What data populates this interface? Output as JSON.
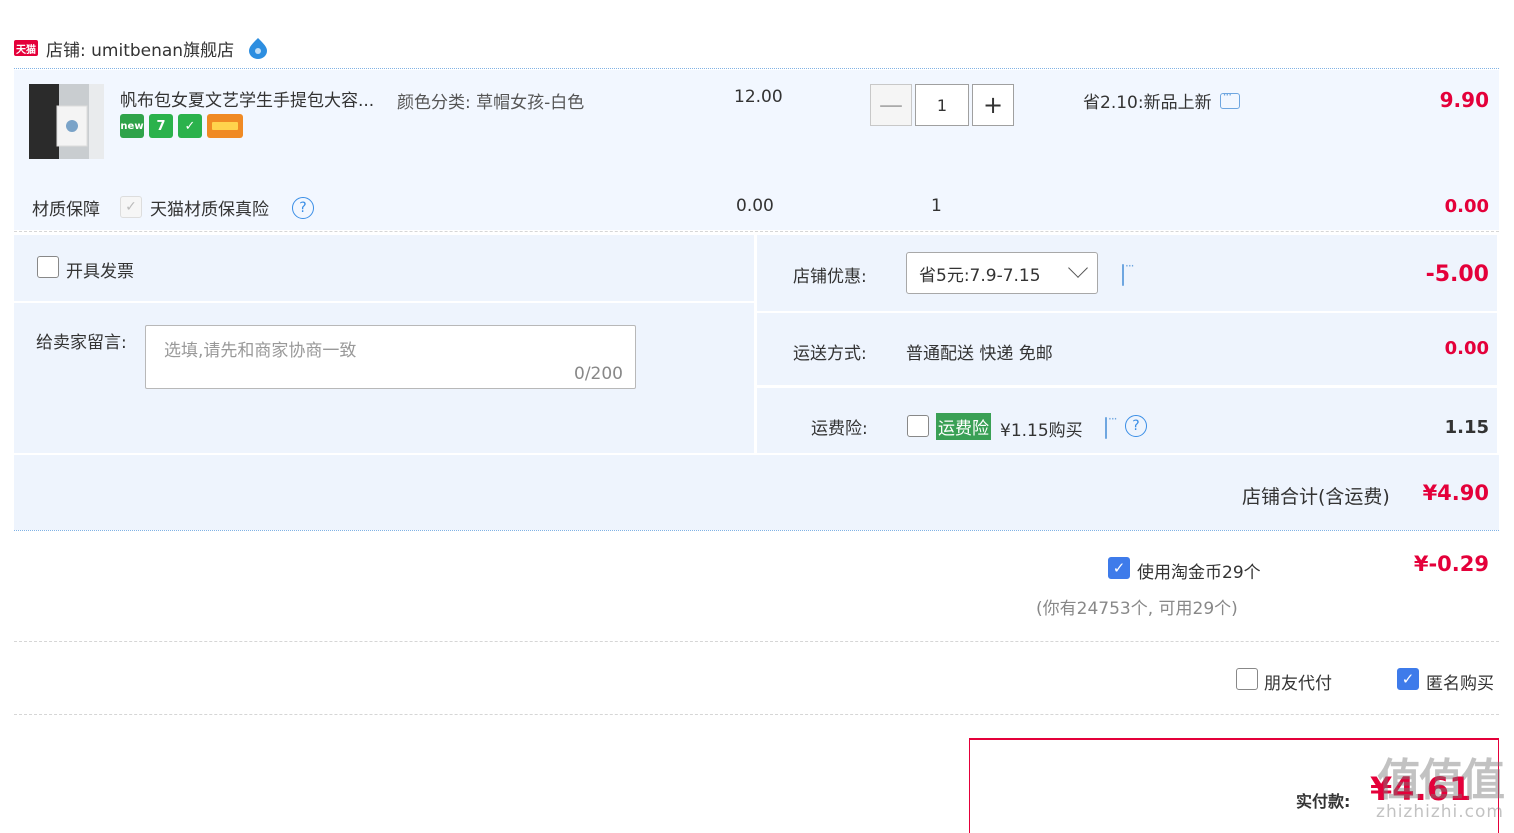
{
  "shop": {
    "badge": "天猫",
    "name": "店铺: umitbenan旗舰店"
  },
  "item": {
    "title": "帆布包女夏文艺学生手提包大容...",
    "sku": "颜色分类: 草帽女孩-白色",
    "price": "12.00",
    "quantity": "1",
    "minus_label": "—",
    "plus_label": "+",
    "promo": "省2.10:新品上新",
    "total": "9.90",
    "badges": [
      {
        "icon": "tmall-new-icon",
        "text": "new",
        "color": "#2fa34a"
      },
      {
        "icon": "seven-day-return-icon",
        "text": "7",
        "color": "#2bb24c"
      },
      {
        "icon": "tmall-guarantee-icon",
        "text": "✓",
        "color": "#2bb24c"
      },
      {
        "icon": "credit-card-icon",
        "text": "",
        "color": "#f08a24"
      }
    ]
  },
  "material": {
    "label": "材质保障",
    "name": "天猫材质保真险",
    "price": "0.00",
    "quantity": "1",
    "total": "0.00"
  },
  "invoice": {
    "label": "开具发票"
  },
  "message": {
    "label": "给卖家留言:",
    "placeholder": "选填,请先和商家协商一致",
    "count": "0/200"
  },
  "discount": {
    "label": "店铺优惠:",
    "selected": "省5元:7.9-7.15",
    "amount": "-5.00"
  },
  "shipping": {
    "label": "运送方式:",
    "method": "普通配送 快递 免邮",
    "amount": "0.00"
  },
  "insurance": {
    "label": "运费险:",
    "tag": "运费险",
    "price_text": "¥1.15购买",
    "amount": "1.15"
  },
  "subtotal": {
    "label": "店铺合计(含运费)",
    "amount": "¥4.90"
  },
  "coins": {
    "label": "使用淘金币29个",
    "amount": "¥-0.29",
    "note": "(你有24753个, 可用29个)"
  },
  "options": {
    "friend_pay": "朋友代付",
    "anonymous": "匿名购买"
  },
  "payment": {
    "label": "实付款:",
    "amount": "¥4.61"
  },
  "watermark": {
    "big": "值值值",
    "small": "zhizhizhi.com"
  },
  "colors": {
    "accent_red": "#e4003a",
    "row_blue": "#f2f7ff",
    "check_blue": "#3e7bea"
  }
}
